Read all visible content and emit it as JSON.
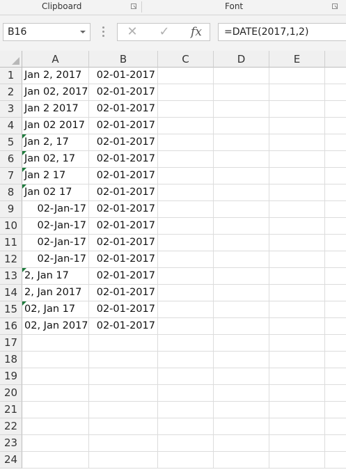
{
  "ribbon": {
    "groups": [
      {
        "label": "Clipboard",
        "launcher": "dialog-launcher-icon"
      },
      {
        "label": "Font",
        "launcher": "dialog-launcher-icon"
      }
    ]
  },
  "formula_bar": {
    "name_box": "B16",
    "cancel_icon": "close-icon",
    "enter_icon": "checkmark-icon",
    "fx_label": "fx",
    "formula": "=DATE(2017,1,2)"
  },
  "sheet": {
    "columns": [
      "A",
      "B",
      "C",
      "D",
      "E"
    ],
    "rows": [
      {
        "num": "1",
        "a": "Jan 2, 2017",
        "a_align": "left",
        "a_flag": false,
        "b": "02-01-2017"
      },
      {
        "num": "2",
        "a": "Jan 02, 2017",
        "a_align": "left",
        "a_flag": false,
        "b": "02-01-2017"
      },
      {
        "num": "3",
        "a": "Jan 2 2017",
        "a_align": "left",
        "a_flag": false,
        "b": "02-01-2017"
      },
      {
        "num": "4",
        "a": "Jan 02 2017",
        "a_align": "left",
        "a_flag": false,
        "b": "02-01-2017"
      },
      {
        "num": "5",
        "a": "Jan 2, 17",
        "a_align": "left",
        "a_flag": true,
        "b": "02-01-2017"
      },
      {
        "num": "6",
        "a": "Jan 02, 17",
        "a_align": "left",
        "a_flag": true,
        "b": "02-01-2017"
      },
      {
        "num": "7",
        "a": "Jan 2 17",
        "a_align": "left",
        "a_flag": true,
        "b": "02-01-2017"
      },
      {
        "num": "8",
        "a": "Jan 02 17",
        "a_align": "left",
        "a_flag": true,
        "b": "02-01-2017"
      },
      {
        "num": "9",
        "a": "02-Jan-17",
        "a_align": "right",
        "a_flag": false,
        "b": "02-01-2017"
      },
      {
        "num": "10",
        "a": "02-Jan-17",
        "a_align": "right",
        "a_flag": false,
        "b": "02-01-2017"
      },
      {
        "num": "11",
        "a": "02-Jan-17",
        "a_align": "right",
        "a_flag": false,
        "b": "02-01-2017"
      },
      {
        "num": "12",
        "a": "02-Jan-17",
        "a_align": "right",
        "a_flag": false,
        "b": "02-01-2017"
      },
      {
        "num": "13",
        "a": "2, Jan 17",
        "a_align": "left",
        "a_flag": true,
        "b": "02-01-2017"
      },
      {
        "num": "14",
        "a": "2, Jan 2017",
        "a_align": "left",
        "a_flag": false,
        "b": "02-01-2017"
      },
      {
        "num": "15",
        "a": "02, Jan 17",
        "a_align": "left",
        "a_flag": true,
        "b": "02-01-2017"
      },
      {
        "num": "16",
        "a": "02, Jan 2017",
        "a_align": "left",
        "a_flag": false,
        "b": "02-01-2017"
      },
      {
        "num": "17",
        "a": "",
        "a_align": "left",
        "a_flag": false,
        "b": ""
      },
      {
        "num": "18",
        "a": "",
        "a_align": "left",
        "a_flag": false,
        "b": ""
      },
      {
        "num": "19",
        "a": "",
        "a_align": "left",
        "a_flag": false,
        "b": ""
      },
      {
        "num": "20",
        "a": "",
        "a_align": "left",
        "a_flag": false,
        "b": ""
      },
      {
        "num": "21",
        "a": "",
        "a_align": "left",
        "a_flag": false,
        "b": ""
      },
      {
        "num": "22",
        "a": "",
        "a_align": "left",
        "a_flag": false,
        "b": ""
      },
      {
        "num": "23",
        "a": "",
        "a_align": "left",
        "a_flag": false,
        "b": ""
      },
      {
        "num": "24",
        "a": "",
        "a_align": "left",
        "a_flag": false,
        "b": ""
      }
    ],
    "flag_color": "#1e7b3c"
  }
}
